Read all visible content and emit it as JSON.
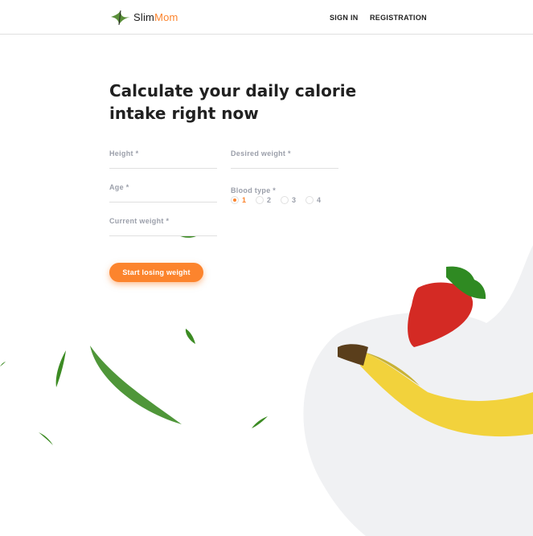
{
  "header": {
    "logo_slim": "Slim",
    "logo_mom": "Mom",
    "nav_signin": "SIGN IN",
    "nav_registration": "REGISTRATION"
  },
  "main": {
    "headline": "Calculate your daily calorie intake right now",
    "fields": {
      "height": {
        "label": "Height *",
        "value": ""
      },
      "age": {
        "label": "Age *",
        "value": ""
      },
      "current_weight": {
        "label": "Current weight *",
        "value": ""
      },
      "desired_weight": {
        "label": "Desired weight *",
        "value": ""
      }
    },
    "blood_type": {
      "label": "Blood type *",
      "options": [
        "1",
        "2",
        "3",
        "4"
      ],
      "selected": "1"
    },
    "submit_label": "Start losing weight"
  },
  "colors": {
    "accent": "#fc842d",
    "label_gray": "#9b9faa",
    "text": "#212121",
    "leaf": "#3c8b23",
    "strawberry": "#d42a24",
    "banana": "#f2d23c",
    "background_shape": "#f0f1f3"
  },
  "icons": [
    "logo-leaf-icon",
    "strawberry-image",
    "banana-image",
    "leaf-image"
  ]
}
